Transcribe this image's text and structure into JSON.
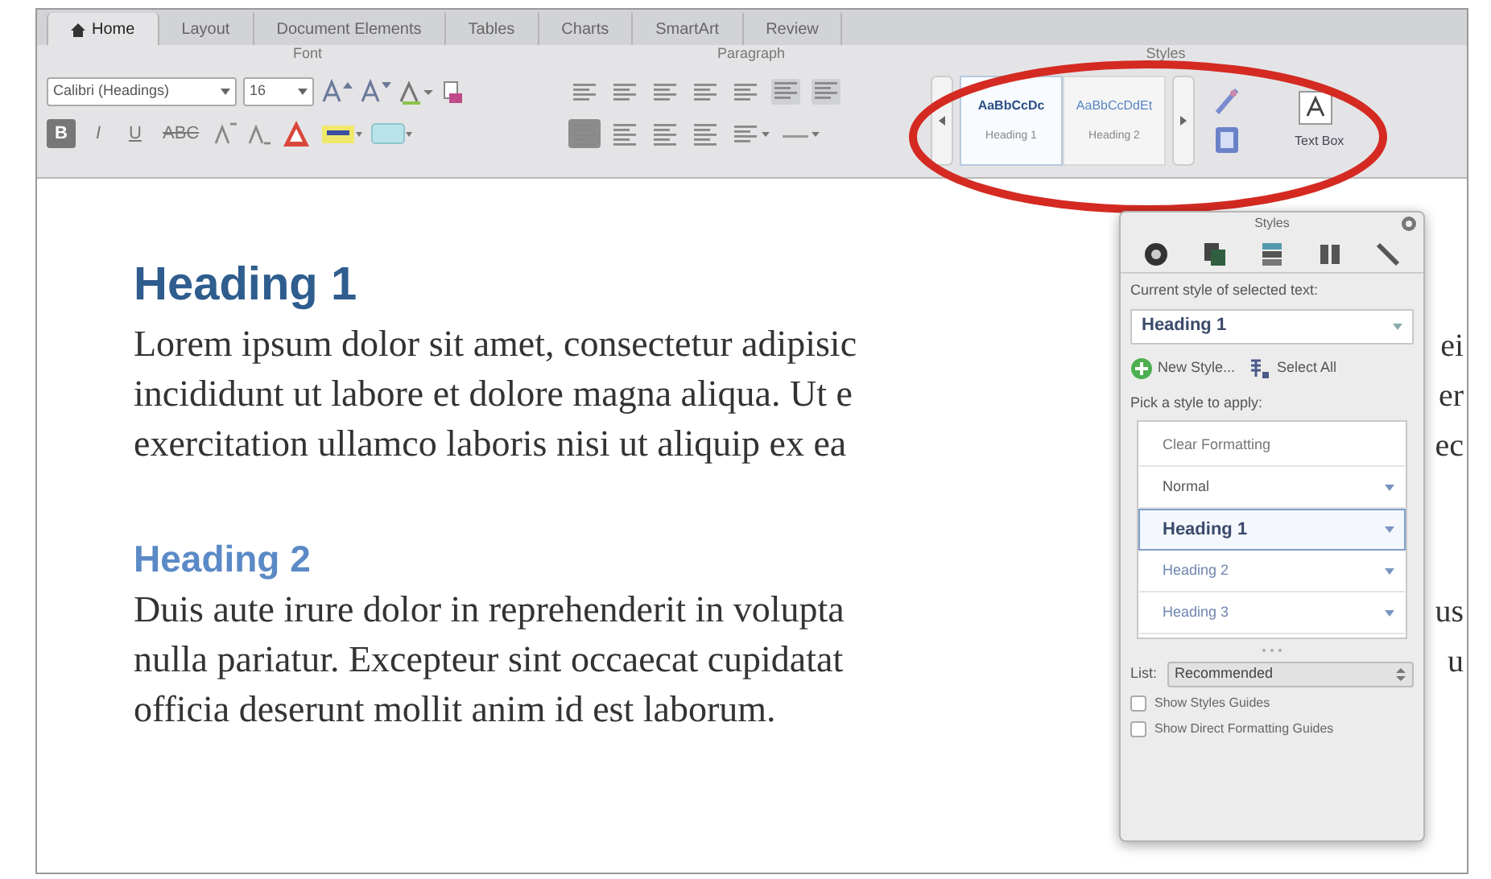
{
  "ribbon": {
    "tabs": [
      {
        "label": "Home",
        "selected": true
      },
      {
        "label": "Layout",
        "selected": false
      },
      {
        "label": "Document Elements",
        "selected": false
      },
      {
        "label": "Tables",
        "selected": false
      },
      {
        "label": "Charts",
        "selected": false
      },
      {
        "label": "SmartArt",
        "selected": false
      },
      {
        "label": "Review",
        "selected": false
      }
    ],
    "groups": [
      "Font",
      "Paragraph",
      "Styles"
    ],
    "font_name": "Calibri (Headings)",
    "font_size": "16",
    "format_buttons": [
      "B",
      "I",
      "U",
      "ABC"
    ],
    "styles_gallery": [
      {
        "sample": "AaBbCcDc",
        "label": "Heading 1",
        "selected": true
      },
      {
        "sample": "AaBbCcDdEt",
        "label": "Heading 2",
        "selected": false
      }
    ],
    "text_box": "Text Box"
  },
  "document": [
    {
      "kind": "heading1",
      "text": "Heading 1"
    },
    {
      "kind": "line",
      "text": "Lorem ipsum dolor sit amet, consectetur adipisic",
      "tail": "ei"
    },
    {
      "kind": "line",
      "text": "incididunt ut labore et dolore magna aliqua. Ut e",
      "tail": "er"
    },
    {
      "kind": "line",
      "text": "exercitation ullamco laboris nisi ut aliquip ex ea",
      "tail": "ec"
    },
    {
      "kind": "gap"
    },
    {
      "kind": "heading2",
      "text": "Heading 2"
    },
    {
      "kind": "line",
      "text": "Duis aute irure dolor in reprehenderit in volupta",
      "tail": "us"
    },
    {
      "kind": "line",
      "text": "nulla pariatur. Excepteur sint occaecat cupidatat",
      "tail": "u"
    },
    {
      "kind": "line",
      "text": "officia deserunt mollit anim id est laborum."
    }
  ],
  "styles_panel": {
    "title": "Styles",
    "current_label": "Current style of selected text:",
    "current_style": "Heading 1",
    "new_style": "New Style...",
    "select_all": "Select All",
    "pick_label": "Pick a style to apply:",
    "styles": [
      {
        "name": "Clear Formatting",
        "kind": "plain",
        "selected": false
      },
      {
        "name": "Normal",
        "kind": "style",
        "selected": false
      },
      {
        "name": "Heading 1",
        "kind": "heading",
        "selected": true
      },
      {
        "name": "Heading 2",
        "kind": "heading",
        "selected": false
      },
      {
        "name": "Heading 3",
        "kind": "heading",
        "selected": false
      }
    ],
    "list_label": "List:",
    "list_value": "Recommended",
    "options": [
      {
        "label": "Show Styles Guides",
        "checked": false
      },
      {
        "label": "Show Direct Formatting Guides",
        "checked": false
      }
    ]
  }
}
